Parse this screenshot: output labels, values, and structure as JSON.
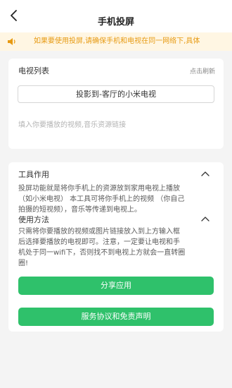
{
  "header": {
    "title": "手机投屏",
    "back_icon": "chevron-left-icon"
  },
  "notice": {
    "icon": "speaker-icon",
    "text": "如果要使用投屏,请确保手机和电视在同一网络下,具体"
  },
  "tv_section": {
    "label": "电视列表",
    "refresh_label": "点击刷新",
    "cast_button_label": "投影到-客厅的小米电视",
    "link_placeholder": "填入你要播放的视频,音乐资源链接",
    "link_value": ""
  },
  "info": {
    "purpose_title": "工具作用",
    "purpose_lines": [
      "投屏功能就是将你手机上的资源放到家用电视上播放",
      "（如小米电视） 本工具可将你手机上的视频 （你自己",
      "拍摄的短视频），音乐等传递到电视上。"
    ],
    "usage_title": "使用方法",
    "usage_lines": [
      "只需将你要播放的视频或图片链接放入到上方输入框",
      "后选择要播放的电视即可。注意，一定要让电视和手",
      "机处于同一wifi下，否则找不到电视上方就会一直转圈",
      "圈!"
    ],
    "collapse_icon": "chevron-up-icon"
  },
  "buttons": {
    "share_label": "分享应用",
    "terms_label": "服务协议和免责声明"
  },
  "colors": {
    "accent_green": "#2fc16b",
    "notice_bg": "#fff6e3",
    "notice_text": "#e79a12"
  }
}
